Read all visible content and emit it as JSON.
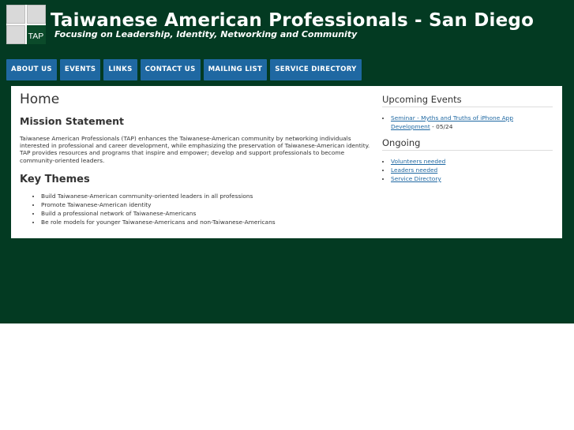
{
  "header": {
    "title": "Taiwanese American Professionals - San Diego",
    "tagline": "Focusing on Leadership, Identity, Networking and Community",
    "logo_text": "TAP"
  },
  "nav": {
    "items": [
      "ABOUT US",
      "EVENTS",
      "LINKS",
      "CONTACT US",
      "MAILING LIST",
      "SERVICE DIRECTORY"
    ]
  },
  "main": {
    "page_title": "Home",
    "mission_heading": "Mission Statement",
    "mission_text": "Taiwanese American Professionals (TAP) enhances the Taiwanese-American community by networking individuals interested in professional and career development, while emphasizing the preservation of Taiwanese-American identity. TAP provides resources and programs that inspire and empower; develop and support professionals to become community-oriented leaders.",
    "themes_heading": "Key Themes",
    "themes": [
      "Build Taiwanese-American community-oriented leaders in all professions",
      "Promote Taiwanese-American identity",
      "Build a professional network of Taiwanese-Americans",
      "Be role models for younger Taiwanese-Americans and non-Taiwanese-Americans"
    ]
  },
  "sidebar": {
    "upcoming_heading": "Upcoming Events",
    "upcoming": [
      {
        "link": "Seminar - Myths and Truths of iPhone App Development",
        "suffix": " - 05/24"
      }
    ],
    "ongoing_heading": "Ongoing",
    "ongoing": [
      "Volunteers needed",
      "Leaders needed",
      "Service Directory"
    ]
  },
  "colors": {
    "background": "#033a22",
    "nav_button": "#1f68a2",
    "link": "#1f68a2"
  }
}
